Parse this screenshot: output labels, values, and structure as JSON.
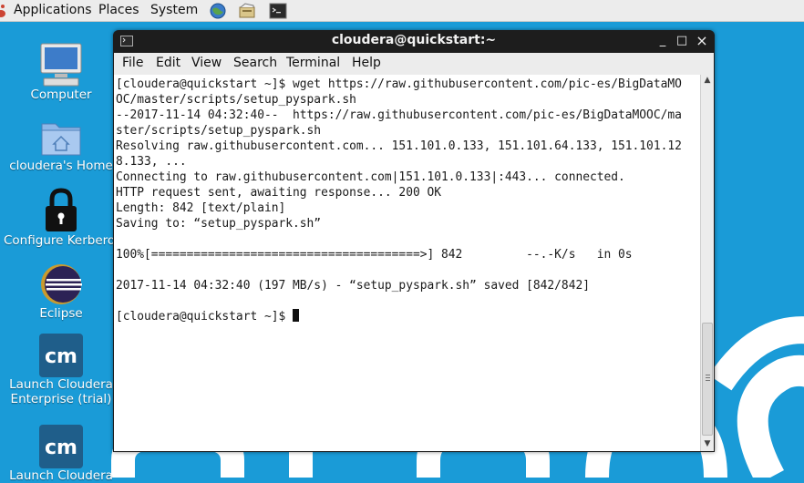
{
  "top_panel": {
    "menus": [
      "Applications",
      "Places",
      "System"
    ],
    "launchers": [
      "browser-icon",
      "file-manager-icon",
      "terminal-icon"
    ]
  },
  "desktop": {
    "icons": [
      {
        "label": "Computer",
        "icon": "computer-icon"
      },
      {
        "label": "cloudera's Home",
        "icon": "home-folder-icon"
      },
      {
        "label": "Configure Kerberos",
        "icon": "lock-icon"
      },
      {
        "label": "Eclipse",
        "icon": "eclipse-icon"
      },
      {
        "label_line1": "Launch Cloudera",
        "label_line2": "Enterprise (trial)",
        "icon": "cloudera-manager-icon",
        "badge": "cm"
      },
      {
        "label": "Launch Cloudera",
        "icon": "cloudera-manager-icon",
        "badge": "cm"
      }
    ]
  },
  "terminal": {
    "title": "cloudera@quickstart:~",
    "window_buttons": {
      "minimize": "_",
      "maximize": "□",
      "close": "×"
    },
    "menu": [
      "File",
      "Edit",
      "View",
      "Search",
      "Terminal",
      "Help"
    ],
    "lines": [
      "[cloudera@quickstart ~]$ wget https://raw.githubusercontent.com/pic-es/BigDataMO",
      "OC/master/scripts/setup_pyspark.sh",
      "--2017-11-14 04:32:40--  https://raw.githubusercontent.com/pic-es/BigDataMOOC/ma",
      "ster/scripts/setup_pyspark.sh",
      "Resolving raw.githubusercontent.com... 151.101.0.133, 151.101.64.133, 151.101.12",
      "8.133, ...",
      "Connecting to raw.githubusercontent.com|151.101.0.133|:443... connected.",
      "HTTP request sent, awaiting response... 200 OK",
      "Length: 842 [text/plain]",
      "Saving to: “setup_pyspark.sh”",
      "",
      "100%[======================================>] 842         --.-K/s   in 0s",
      "",
      "2017-11-14 04:32:40 (197 MB/s) - “setup_pyspark.sh” saved [842/842]",
      ""
    ],
    "prompt": "[cloudera@quickstart ~]$ "
  },
  "colors": {
    "desktop_bg": "#1a9bd7",
    "terminal_titlebar": "#1d1d1d",
    "panel_bg": "#ececec",
    "cloudera_badge": "#1f5e8a"
  }
}
